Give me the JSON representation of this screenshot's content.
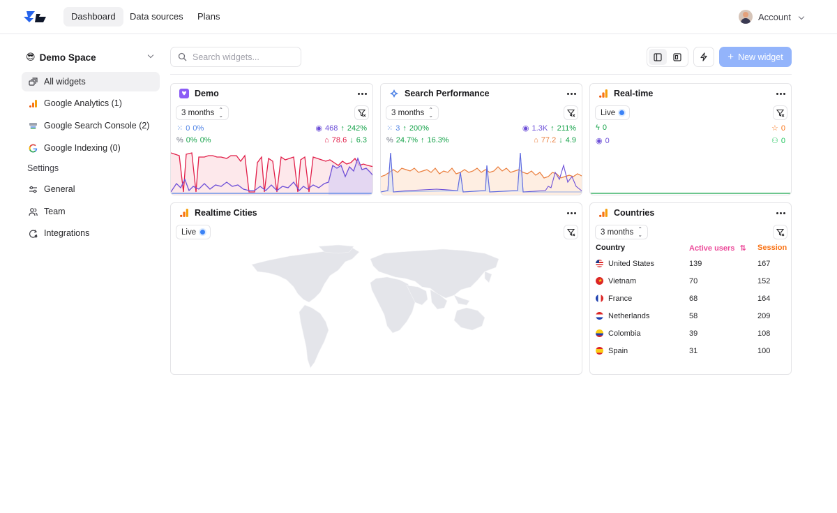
{
  "nav": {
    "tabs": [
      "Dashboard",
      "Data sources",
      "Plans"
    ],
    "account_label": "Account"
  },
  "sidebar": {
    "space_name": "Demo Space",
    "space_emoji": "😎",
    "items": [
      {
        "label": "All widgets",
        "icon": "widgets-icon"
      },
      {
        "label": "Google Analytics (1)",
        "icon": "google-analytics-icon"
      },
      {
        "label": "Google Search Console (2)",
        "icon": "search-console-icon"
      },
      {
        "label": "Google Indexing (0)",
        "icon": "google-icon"
      }
    ],
    "settings_heading": "Settings",
    "settings_items": [
      {
        "label": "General",
        "icon": "sliders-icon"
      },
      {
        "label": "Team",
        "icon": "users-icon"
      },
      {
        "label": "Integrations",
        "icon": "integrations-icon"
      }
    ]
  },
  "toolbar": {
    "search_placeholder": "Search widgets...",
    "new_widget_label": "New widget"
  },
  "widgets": {
    "demo": {
      "title": "Demo",
      "range": "3 months",
      "metrics": {
        "m1_value": "0",
        "m1_change": "0%",
        "m2_value": "468",
        "m2_change": "242%",
        "m3_value": "0%",
        "m3_change": "0%",
        "m4_value": "78.6",
        "m4_change": "6.3"
      }
    },
    "search": {
      "title": "Search Performance",
      "range": "3 months",
      "metrics": {
        "m1_value": "3",
        "m1_change": "200%",
        "m2_value": "1.3K",
        "m2_change": "211%",
        "m3_value": "24.7%",
        "m3_change": "16.3%",
        "m4_value": "77.2",
        "m4_change": "4.9"
      }
    },
    "realtime": {
      "title": "Real-time",
      "live_label": "Live",
      "m1_value": "0",
      "m2_value": "0",
      "m3_value": "0",
      "m4_value": "0"
    },
    "cities": {
      "title": "Realtime Cities",
      "live_label": "Live"
    },
    "countries": {
      "title": "Countries",
      "range": "3 months",
      "headers": [
        "Country",
        "Active users",
        "Session"
      ],
      "rows": [
        {
          "country": "United States",
          "users": "139",
          "sessions": "167"
        },
        {
          "country": "Vietnam",
          "users": "70",
          "sessions": "152"
        },
        {
          "country": "France",
          "users": "68",
          "sessions": "164"
        },
        {
          "country": "Netherlands",
          "users": "58",
          "sessions": "209"
        },
        {
          "country": "Colombia",
          "users": "39",
          "sessions": "108"
        },
        {
          "country": "Spain",
          "users": "31",
          "sessions": "100"
        }
      ]
    }
  },
  "colors": {
    "accent": "#93b4fb",
    "demo_red": "#e11d48",
    "demo_purple": "#6d4fd8",
    "search_orange": "#ea7c3a",
    "search_blue": "#4f83e6",
    "positive": "#16a34a",
    "active_users_header": "#ec4899",
    "sessions_header": "#f97316"
  }
}
